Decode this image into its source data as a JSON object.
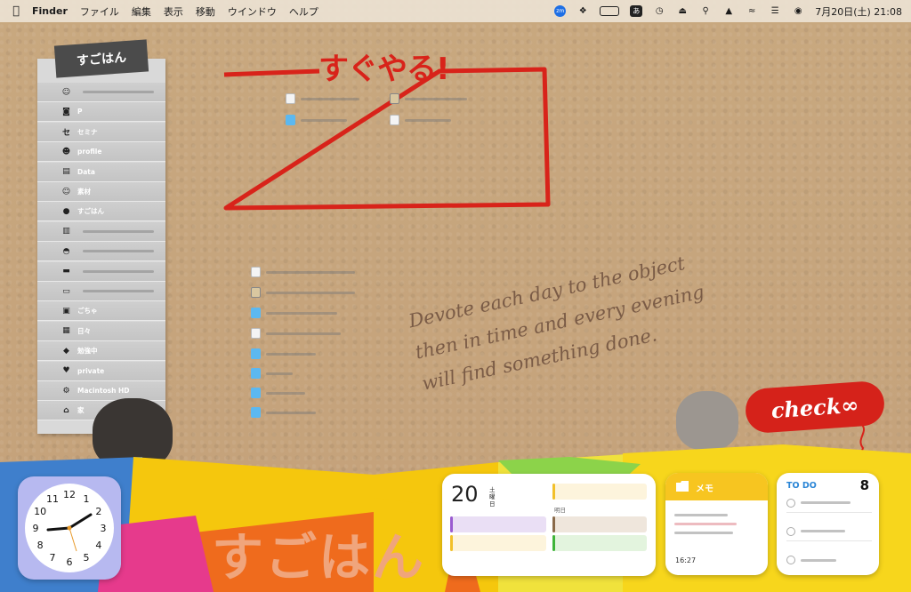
{
  "menubar": {
    "apple_icon": "apple-logo-icon",
    "app_name": "Finder",
    "menus": [
      "ファイル",
      "編集",
      "表示",
      "移動",
      "ウインドウ",
      "ヘルプ"
    ],
    "status_zm": "zm",
    "battery_label": "☐",
    "input_method": "あ",
    "date_time": "7月20日(土)  21:08"
  },
  "left_panel": {
    "tape_label": "すごはん",
    "items": [
      {
        "label": "",
        "icon": "smile-face-icon"
      },
      {
        "label": "P",
        "icon": "camera-icon"
      },
      {
        "label": "セミナ",
        "icon": "seminar-icon"
      },
      {
        "label": "profile",
        "icon": "person-icon"
      },
      {
        "label": "Data",
        "icon": "box-icon"
      },
      {
        "label": "素材",
        "icon": "smiley-icon"
      },
      {
        "label": "すごはん",
        "icon": "character-icon"
      },
      {
        "label": "",
        "icon": "archive-icon"
      },
      {
        "label": "",
        "icon": "dumpling-icon"
      },
      {
        "label": "",
        "icon": "car-icon"
      },
      {
        "label": "",
        "icon": "laptop-icon"
      },
      {
        "label": "ごちゃ",
        "icon": "robot-icon"
      },
      {
        "label": "日々",
        "icon": "calendar-character-icon"
      },
      {
        "label": "勉強中",
        "icon": "cat-face-icon"
      },
      {
        "label": "private",
        "icon": "heart-icon"
      },
      {
        "label": "Macintosh HD",
        "icon": "gear-icon"
      },
      {
        "label": "家",
        "icon": "house-icon"
      }
    ]
  },
  "frame": {
    "title": "すぐやる!"
  },
  "quote": {
    "line1": "Devote each day to the object",
    "line2": "then in time and every evening",
    "line3": "will find something done."
  },
  "check_badge": {
    "label": "check∞"
  },
  "collage": {
    "brand_text": "すごはん"
  },
  "calendar_widget": {
    "day": "20",
    "weekday_line1": "土",
    "weekday_line2": "曜",
    "weekday_line3": "日",
    "tomorrow_label": "明日"
  },
  "memo_widget": {
    "title": "メモ",
    "time": "16:27"
  },
  "todo_widget": {
    "title": "TO DO",
    "count": "8"
  },
  "clock_widget": {
    "numbers": [
      "12",
      "1",
      "2",
      "3",
      "4",
      "5",
      "6",
      "7",
      "8",
      "9",
      "10",
      "11"
    ]
  }
}
